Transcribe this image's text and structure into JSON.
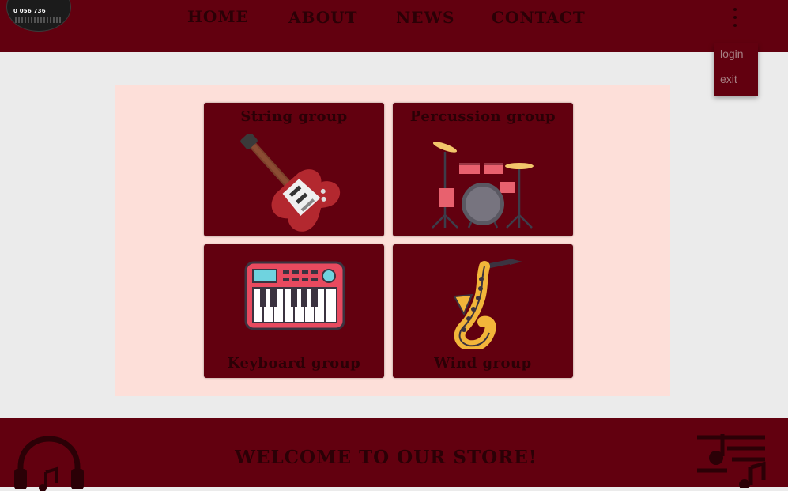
{
  "header": {
    "logo": {
      "text": "0 056 736",
      "icon": "store-logo"
    },
    "nav": [
      {
        "label": "HOME"
      },
      {
        "label": "ABOUT"
      },
      {
        "label": "NEWS"
      },
      {
        "label": "CONTACT"
      }
    ],
    "menu_icon": "kebab-menu-icon",
    "menu": {
      "login": "login",
      "exit": "exit"
    }
  },
  "groups": [
    {
      "title": "String group",
      "icon": "electric-guitar-icon"
    },
    {
      "title": "Percussion group",
      "icon": "drum-kit-icon"
    },
    {
      "title": "Keyboard group",
      "icon": "synthesizer-keyboard-icon"
    },
    {
      "title": "Wind group",
      "icon": "saxophone-icon"
    }
  ],
  "footer": {
    "welcome": "WELCOME TO OUR STORE!",
    "left_icon": "headphones-music-icon",
    "right_icon": "music-notes-icon"
  },
  "colors": {
    "primary": "#62000f",
    "text_dark": "#2b0006",
    "panel": "#fddfd9",
    "background": "#ebebeb",
    "menu_text": "#a67f83"
  }
}
